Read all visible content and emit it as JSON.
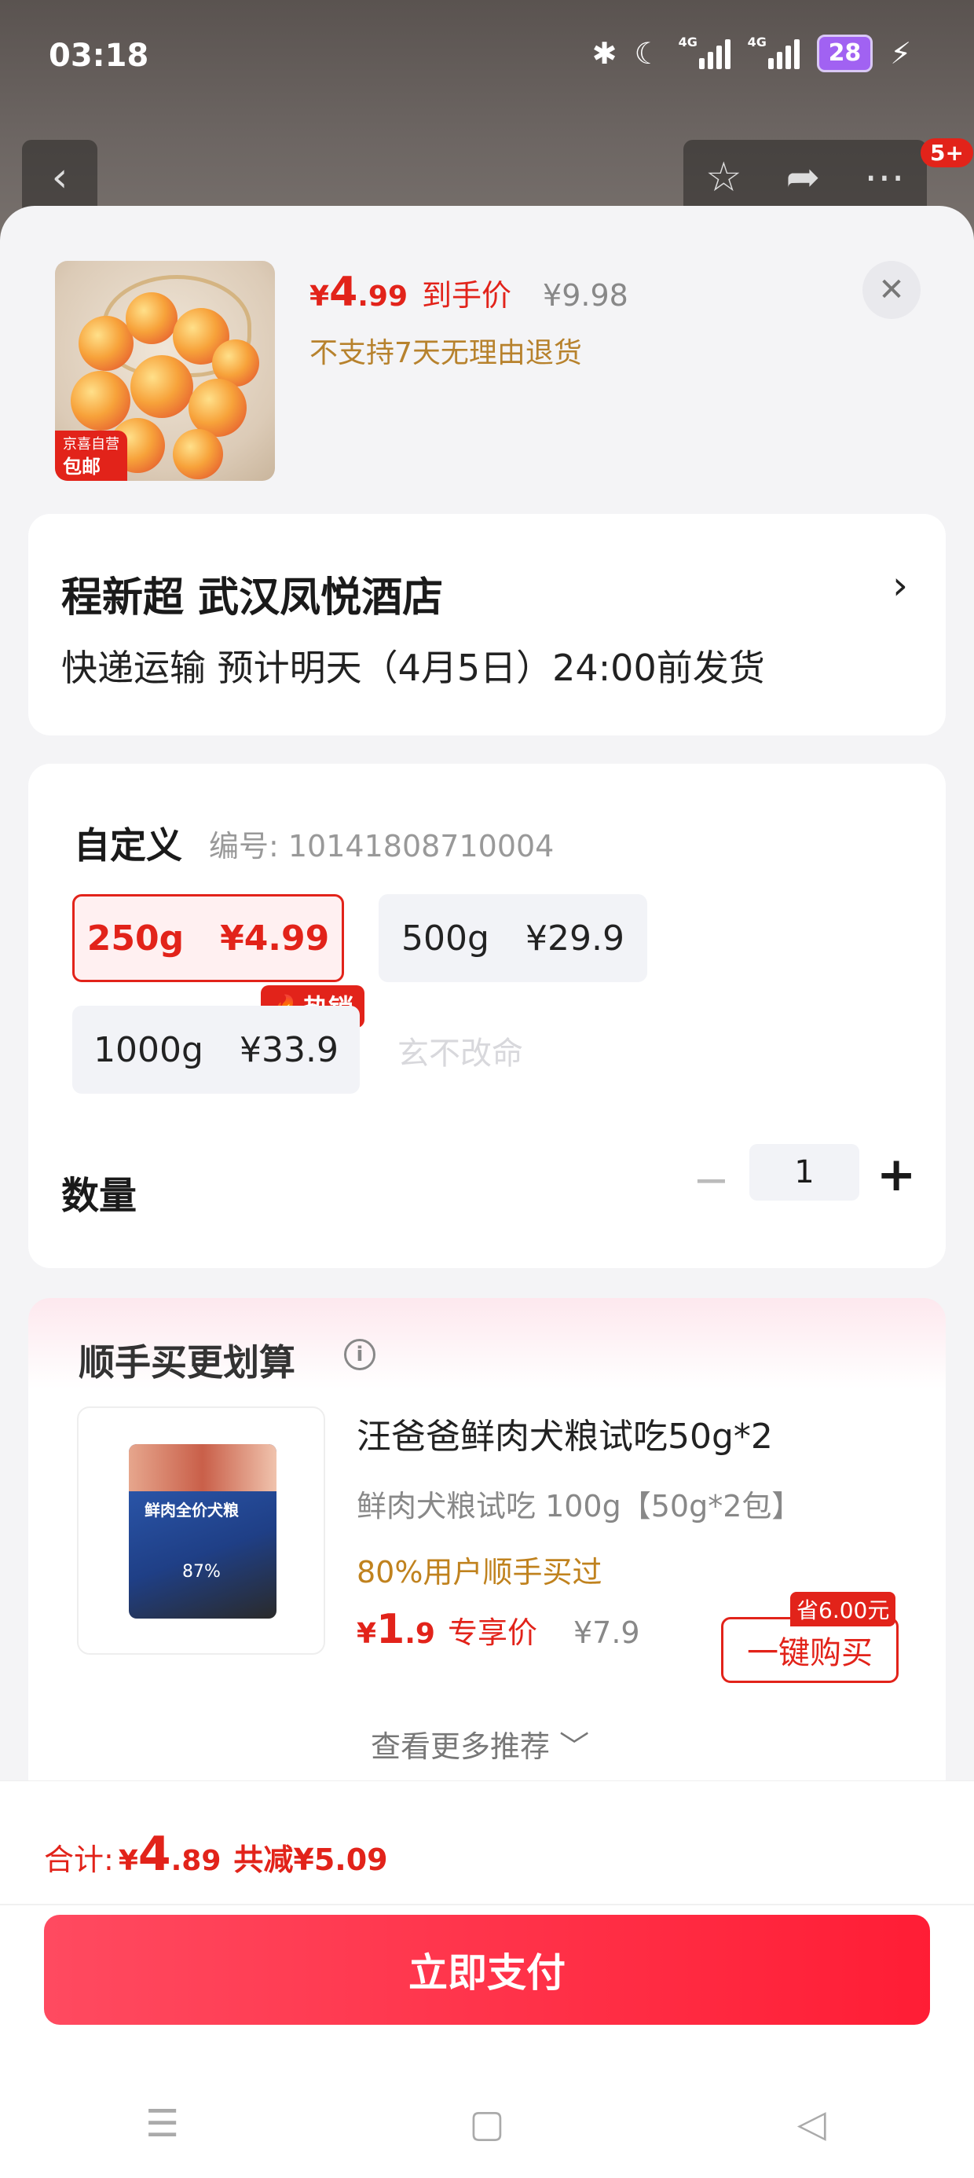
{
  "status_bar": {
    "time": "03:18",
    "network_1": "4G",
    "network_2": "4G",
    "battery": "28"
  },
  "top_nav": {
    "badge": "5+"
  },
  "product": {
    "price_symbol": "¥",
    "price_int": "4",
    "price_dec": ".99",
    "price_label": "到手价",
    "original_price": "¥9.98",
    "return_note": "不支持7天无理由退货",
    "image_tag_line1": "京喜自营",
    "image_tag_line2": "包邮"
  },
  "address": {
    "name": "程新超  武汉凤悦酒店",
    "shipping": "快递运输 预计明天（4月5日）24:00前发货"
  },
  "spec": {
    "title": "自定义",
    "code": "编号: 10141808710004",
    "options": [
      {
        "weight": "250g",
        "price": "¥4.99",
        "selected": true
      },
      {
        "weight": "500g",
        "price": "¥29.9",
        "selected": false
      },
      {
        "weight": "1000g",
        "price": "¥33.9",
        "selected": false
      }
    ],
    "hot_tag": "热销",
    "ghost_text": "玄不改命",
    "quantity_label": "数量",
    "quantity": "1"
  },
  "recommend": {
    "title": "顺手买更划算",
    "product_name": "汪爸爸鲜肉犬粮试吃50g*2",
    "product_spec": "鲜肉犬粮试吃   100g【50g*2包】",
    "buyers_note": "80%用户顺手买过",
    "price_symbol": "¥",
    "price_int": "1",
    "price_dec": ".9",
    "price_label": "专享价",
    "original_price": "¥7.9",
    "buy_button": "一键购买",
    "save_badge": "省6.00元",
    "bag_label": "鲜肉全价犬粮",
    "bag_pct": "87%",
    "more_link": "查看更多推荐 ﹀"
  },
  "footer": {
    "total_label": "合计:",
    "total_symbol": "¥",
    "total_int": "4",
    "total_dec": ".89",
    "discount": "共减¥5.09",
    "pay_button": "立即支付"
  },
  "colors": {
    "accent": "#e2231a",
    "gold": "#b7822d",
    "pay_gradient_start": "#ff4a60",
    "pay_gradient_end": "#ff1d35"
  },
  "icons": [
    "back-icon",
    "star-icon",
    "share-icon",
    "more-icon",
    "close-icon",
    "chevron-right-icon",
    "fire-icon",
    "info-icon",
    "menu-icon",
    "home-icon",
    "back-triangle-icon"
  ]
}
